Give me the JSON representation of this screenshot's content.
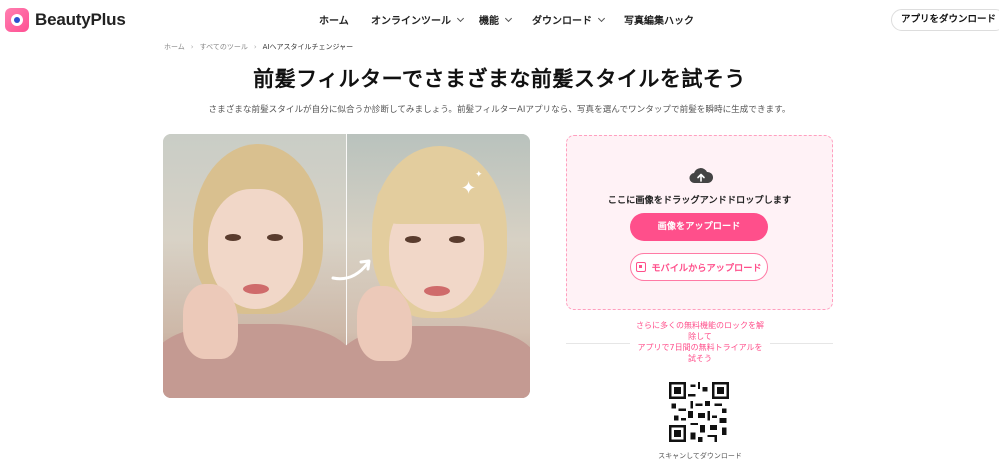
{
  "header": {
    "logo_text": "BeautyPlus",
    "nav": [
      "ホーム",
      "オンラインツール",
      "機能",
      "ダウンロード",
      "写真編集ハック"
    ],
    "app_button": "アプリをダウンロード"
  },
  "breadcrumb": [
    "ホーム",
    "すべてのツール",
    "AIヘアスタイルチェンジャー"
  ],
  "hero": {
    "title": "前髪フィルターでさまざまな前髪スタイルを試そう",
    "subtitle": "さまざまな前髪スタイルが自分に似合うか診断してみましょう。前髪フィルターAIアプリなら、写真を選んでワンタップで前髪を瞬時に生成できます。"
  },
  "upload": {
    "drop_text": "ここに画像をドラッグアンドドロップします",
    "upload_button": "画像をアップロード",
    "mobile_button": "モバイルからアップロード"
  },
  "promo": {
    "line1": "さらに多くの無料機能のロックを解",
    "line2": "除して",
    "line3": "アプリで7日間の無料トライアルを",
    "line4": "試そう"
  },
  "qr_caption": "スキャンしてダウンロード",
  "colors": {
    "accent": "#ff4f8b",
    "panel_bg": "#fff2f6"
  }
}
